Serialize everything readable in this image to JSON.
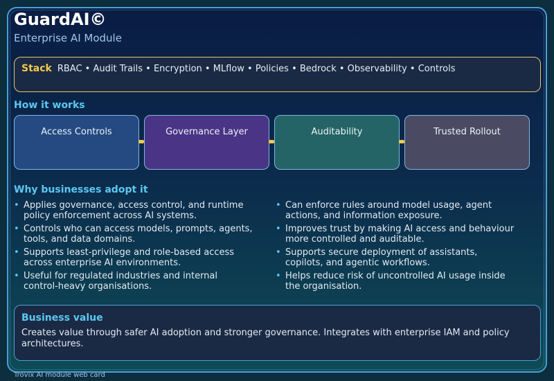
{
  "header": {
    "title": "GuardAI©",
    "subtitle": "Enterprise AI Module"
  },
  "stack": {
    "label": "Stack",
    "items": "RBAC • Audit Trails • Encryption • MLflow • Policies • Bedrock • Observability • Controls"
  },
  "how_it_works": {
    "heading": "How it works",
    "steps": [
      "Access Controls",
      "Governance Layer",
      "Auditability",
      "Trusted Rollout"
    ],
    "colors": [
      "#254a82",
      "#4a3486",
      "#246466",
      "#4a4a62"
    ]
  },
  "why": {
    "heading": "Why businesses adopt it",
    "left": [
      "Applies governance, access control, and runtime policy enforcement across AI systems.",
      "Controls who can access models, prompts, agents, tools, and data domains.",
      "Supports least-privilege and role-based access across enterprise AI environments.",
      "Useful for regulated industries and internal control-heavy organisations."
    ],
    "right": [
      "Can enforce rules around model usage, agent actions, and information exposure.",
      "Improves trust by making AI access and behaviour more controlled and auditable.",
      "Supports secure deployment of assistants, copilots, and agentic workflows.",
      "Helps reduce risk of uncontrolled AI usage inside the organisation."
    ]
  },
  "value": {
    "title": "Business value",
    "text": "Creates value through safer AI adoption and stronger governance. Integrates with enterprise IAM and policy architectures."
  },
  "footer": "Trovix AI module web card"
}
